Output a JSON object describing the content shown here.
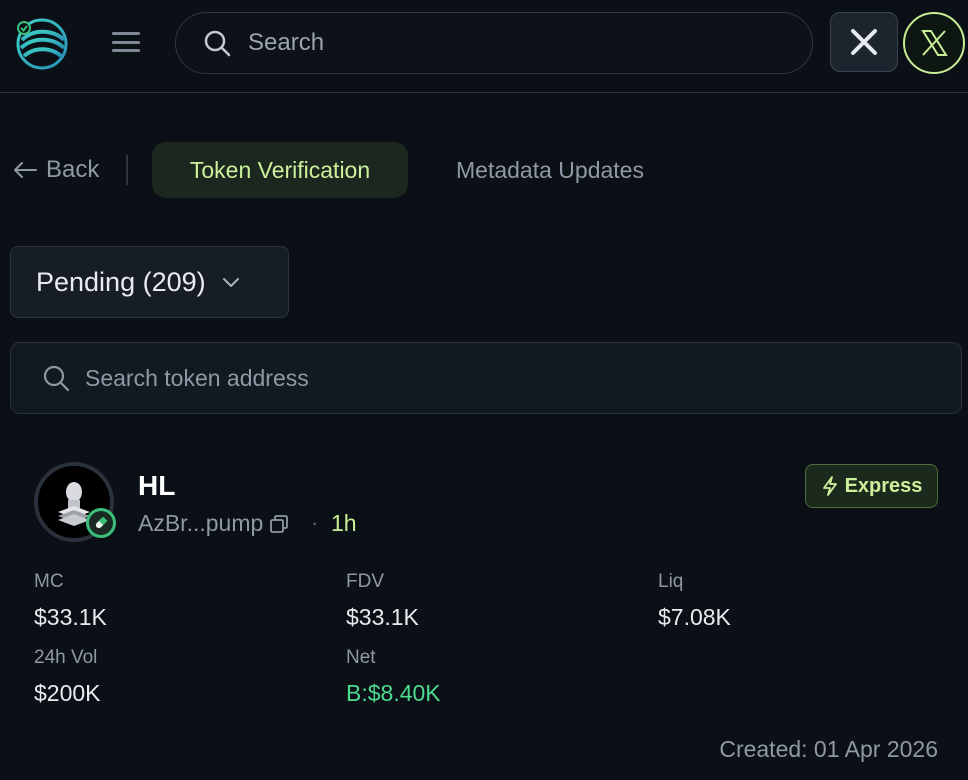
{
  "header": {
    "search_placeholder": "Search",
    "x_button_label": "X",
    "profile_label": "X"
  },
  "nav": {
    "back_label": "Back",
    "tabs": [
      {
        "label": "Token Verification",
        "active": true
      },
      {
        "label": "Metadata Updates",
        "active": false
      }
    ]
  },
  "filter": {
    "selected": "Pending (209)"
  },
  "token_search": {
    "placeholder": "Search token address"
  },
  "token": {
    "name": "HL",
    "address": "AzBr...pump",
    "separator": "·",
    "age": "1h",
    "badge": "Express",
    "stats": {
      "mc_label": "MC",
      "mc_value": "$33.1K",
      "fdv_label": "FDV",
      "fdv_value": "$33.1K",
      "liq_label": "Liq",
      "liq_value": "$7.08K",
      "vol_label": "24h Vol",
      "vol_value": "$200K",
      "net_label": "Net",
      "net_value": "B:$8.40K"
    },
    "created": "Created: 01 Apr 2026"
  },
  "colors": {
    "accent": "#c7ee94",
    "background": "#0b1016",
    "positive": "#4ddb8f"
  },
  "icons": [
    "logo-icon",
    "menu-icon",
    "search-icon",
    "x-logo-icon",
    "arrow-left-icon",
    "chevron-down-icon",
    "copy-icon",
    "lightning-icon",
    "pill-icon"
  ]
}
